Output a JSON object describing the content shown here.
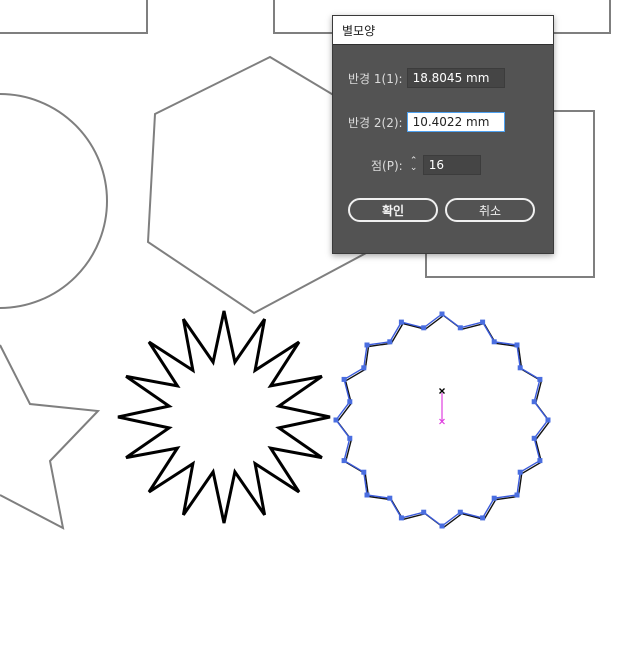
{
  "dialog": {
    "title": "별모양",
    "radius1": {
      "label": "반경 1(1):",
      "value": "18.8045 mm"
    },
    "radius2": {
      "label": "반경 2(2):",
      "value": "10.4022 mm"
    },
    "points": {
      "label": "점(P):",
      "value": "16"
    },
    "ok_label": "확인",
    "cancel_label": "취소"
  },
  "colors": {
    "dialog_bg": "#535353",
    "focus_border": "#4ea1f0",
    "selection_blue": "#3b5bdb",
    "center_magenta": "#e040e0",
    "shape_gray": "#7f7f7f"
  },
  "icons": {
    "stepper": "up-down-chevron-icon",
    "center_mark": "x-mark-icon"
  }
}
